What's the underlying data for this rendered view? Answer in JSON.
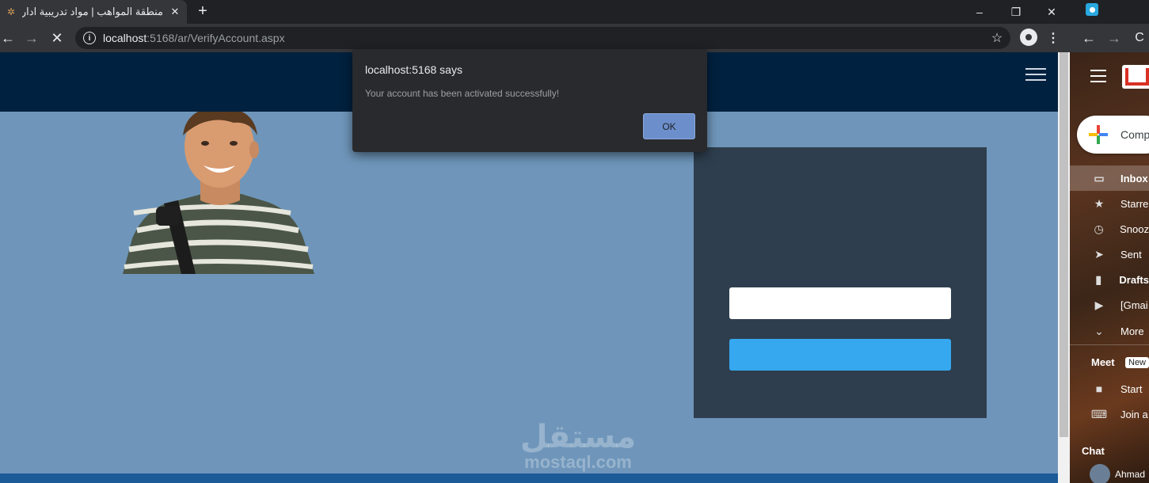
{
  "left_window": {
    "tab": {
      "title": "منطقة المواهب | مواد تدريبية ادارة",
      "favicon": "ornament-icon",
      "close_glyph": "✕"
    },
    "new_tab_glyph": "+",
    "window_controls": {
      "minimize": "–",
      "maximize": "❐",
      "close": "✕"
    },
    "nav": {
      "back": "←",
      "forward": "→",
      "stop": "✕"
    },
    "omnibox": {
      "host": "localhost",
      "path": ":5168/ar/VerifyAccount.aspx"
    },
    "star_glyph": "☆",
    "menu_glyph": "⋮"
  },
  "alert": {
    "title": "localhost:5168 says",
    "message": "Your account has been activated successfully!",
    "ok_label": "OK"
  },
  "page": {
    "watermark_ar": "مستقل",
    "watermark_en": "mostaql.com",
    "code_input_value": "",
    "submit_label": ""
  },
  "right_window": {
    "nav": {
      "back": "←",
      "forward": "→",
      "reload": "C"
    },
    "compose_label": "Comp",
    "items": [
      {
        "icon": "inbox-icon",
        "glyph": "▭",
        "label": "Inbox"
      },
      {
        "icon": "star-icon",
        "glyph": "★",
        "label": "Starre"
      },
      {
        "icon": "clock-icon",
        "glyph": "◷",
        "label": "Snooz"
      },
      {
        "icon": "send-icon",
        "glyph": "➤",
        "label": "Sent"
      },
      {
        "icon": "draft-icon",
        "glyph": "▮",
        "label": "Drafts"
      },
      {
        "icon": "label-icon",
        "glyph": "▶",
        "label": "[Gmai"
      },
      {
        "icon": "chevron-down-icon",
        "glyph": "⌄",
        "label": "More"
      }
    ],
    "meet": {
      "title": "Meet",
      "badge": "New",
      "start": "Start",
      "join": "Join a"
    },
    "chat": {
      "title": "Chat",
      "user": "Ahmad"
    }
  },
  "colors": {
    "page_bg": "#6f96ba",
    "site_header": "#00213f",
    "panel": "#2e3e4e",
    "submit_button": "#35a8ef",
    "alert_ok": "#6c8fcc"
  }
}
